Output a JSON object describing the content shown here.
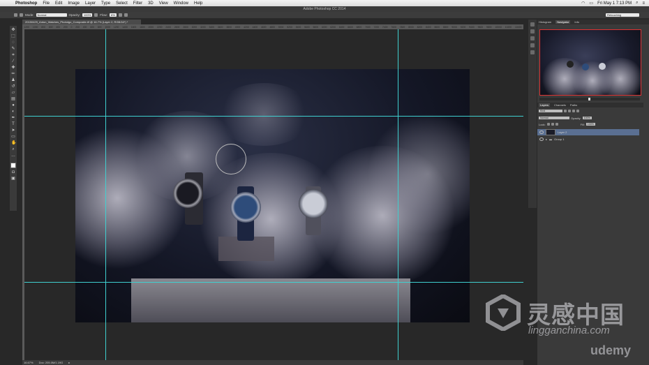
{
  "menubar": {
    "app_name": "Photoshop",
    "items": [
      "File",
      "Edit",
      "Image",
      "Layer",
      "Type",
      "Select",
      "Filter",
      "3D",
      "View",
      "Window",
      "Help"
    ],
    "clock": "Fri May 1  7:13 PM"
  },
  "window": {
    "title": "Adobe Photoshop CC 2014"
  },
  "options": {
    "mode_label": "Mode:",
    "mode_value": "Normal",
    "opacity_label": "Opacity:",
    "opacity_value": "100%",
    "flow_label": "Flow:",
    "flow_value": "6%",
    "workspace": "Retouching"
  },
  "document": {
    "tab_title": "20150429_Anton_Watches_Phototgo_Composite.tif @ 16.7% (Layer 2, RGB/16*) *",
    "zoom": "16.67%",
    "doc_size": "Doc: 205.0M/1.19G"
  },
  "ruler": {
    "ticks": [
      "1200",
      "1000",
      "800",
      "600",
      "400",
      "200",
      "0",
      "200",
      "400",
      "600",
      "800",
      "1000",
      "1200",
      "1400",
      "1600",
      "1800",
      "2000",
      "2200",
      "2400",
      "2600",
      "2800",
      "3000",
      "3200",
      "3400",
      "3600",
      "3800",
      "4000",
      "4200",
      "4400",
      "4600",
      "4800",
      "5000",
      "5200",
      "5400",
      "5600",
      "5800",
      "6000",
      "6200",
      "6400",
      "6600",
      "6800",
      "7000",
      "7200",
      "7400",
      "7600",
      "7800",
      "8000",
      "8200",
      "8400",
      "8600",
      "8800",
      "9000",
      "9200",
      "9400",
      "9600",
      "9800",
      "10000",
      "10200",
      "10400"
    ]
  },
  "navigator": {
    "tabs": [
      "Histogram",
      "Navigator",
      "Info"
    ],
    "active_tab": "Navigator",
    "zoom": "16.67%"
  },
  "layers": {
    "tabs": [
      "Layers",
      "Channels",
      "Paths"
    ],
    "active_tab": "Layers",
    "kind_filter": "Kind",
    "blend_mode": "Normal",
    "opacity_label": "Opacity:",
    "opacity_value": "100%",
    "lock_label": "Lock:",
    "fill_label": "Fill:",
    "fill_value": "100%",
    "items": [
      {
        "name": "Layer 2",
        "selected": true
      },
      {
        "name": "Group 1",
        "selected": false
      }
    ]
  },
  "watermarks": {
    "cn": "灵感中国",
    "en": "lingganchina.com",
    "udemy": "udemy"
  },
  "colors": {
    "guide": "#3fd0d0",
    "selected_layer": "#5a6f92",
    "nav_frame": "#d33333"
  }
}
